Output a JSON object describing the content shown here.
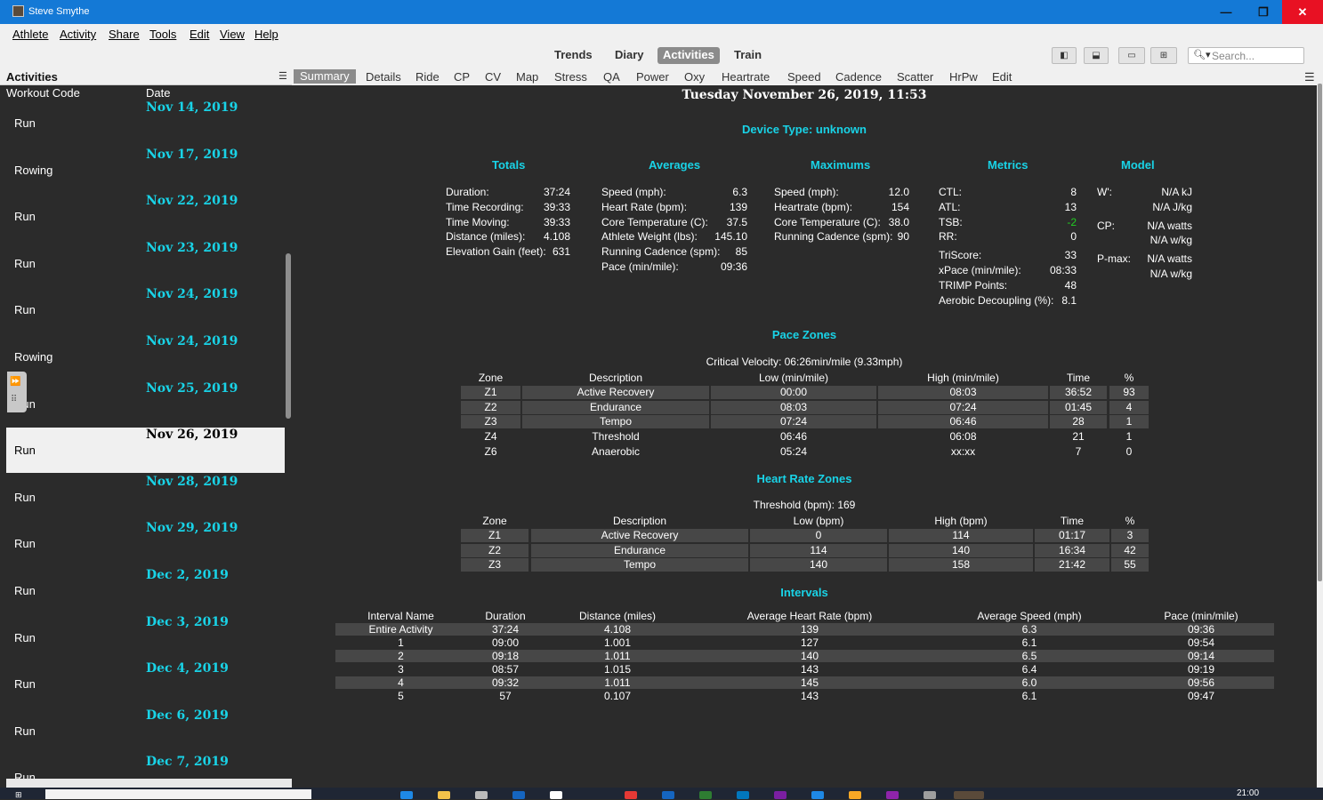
{
  "window": {
    "title": "Steve Smythe",
    "min": "—",
    "max": "❐",
    "close": "✕"
  },
  "menu": [
    "Athlete",
    "Activity",
    "Share",
    "Tools",
    "Edit",
    "View",
    "Help"
  ],
  "views": [
    "Trends",
    "Diary",
    "Activities",
    "Train"
  ],
  "active_view": "Activities",
  "search_placeholder": "Search...",
  "sidebar": {
    "title": "Activities",
    "col_code": "Workout Code",
    "col_date": "Date",
    "items": [
      {
        "date": "Nov 14, 2019",
        "type": "Run"
      },
      {
        "date": "Nov 17, 2019",
        "type": "Rowing"
      },
      {
        "date": "Nov 22, 2019",
        "type": "Run"
      },
      {
        "date": "Nov 23, 2019",
        "type": "Run"
      },
      {
        "date": "Nov 24, 2019",
        "type": "Run"
      },
      {
        "date": "Nov 24, 2019",
        "type": "Rowing"
      },
      {
        "date": "Nov 25, 2019",
        "type": "Run"
      },
      {
        "date": "Nov 26, 2019",
        "type": "Run",
        "selected": true
      },
      {
        "date": "Nov 28, 2019",
        "type": "Run"
      },
      {
        "date": "Nov 29, 2019",
        "type": "Run"
      },
      {
        "date": "Dec 2, 2019",
        "type": "Run"
      },
      {
        "date": "Dec 3, 2019",
        "type": "Run"
      },
      {
        "date": "Dec 4, 2019",
        "type": "Run"
      },
      {
        "date": "Dec 6, 2019",
        "type": "Run"
      },
      {
        "date": "Dec 7, 2019",
        "type": "Run"
      }
    ]
  },
  "tabs": [
    "Summary",
    "Details",
    "Ride",
    "CP",
    "CV",
    "Map",
    "Stress",
    "QA",
    "Power",
    "Oxy",
    "Heartrate",
    "Speed",
    "Cadence",
    "Scatter",
    "HrPw",
    "Edit"
  ],
  "active_tab": "Summary",
  "summary": {
    "datetime": "Tuesday November 26, 2019, 11:53",
    "device": "Device Type: unknown",
    "sections": {
      "totals": "Totals",
      "averages": "Averages",
      "maximums": "Maximums",
      "metrics": "Metrics",
      "model": "Model"
    },
    "totals": [
      [
        "Duration:",
        "37:24"
      ],
      [
        "Time Recording:",
        "39:33"
      ],
      [
        "Time Moving:",
        "39:33"
      ],
      [
        "Distance (miles):",
        "4.108"
      ],
      [
        "Elevation Gain (feet):",
        "631"
      ]
    ],
    "averages": [
      [
        "Speed (mph):",
        "6.3"
      ],
      [
        "Heart Rate (bpm):",
        "139"
      ],
      [
        "Core Temperature (C):",
        "37.5"
      ],
      [
        "Athlete Weight (lbs):",
        "145.10"
      ],
      [
        "Running Cadence (spm):",
        "85"
      ],
      [
        "Pace (min/mile):",
        "09:36"
      ]
    ],
    "maximums": [
      [
        "Speed (mph):",
        "12.0"
      ],
      [
        "Heartrate (bpm):",
        "154"
      ],
      [
        "Core Temperature (C):",
        "38.0"
      ],
      [
        "Running Cadence (spm):",
        "90"
      ]
    ],
    "metrics": [
      [
        "CTL:",
        "8"
      ],
      [
        "ATL:",
        "13"
      ],
      [
        "TSB:",
        "-2"
      ],
      [
        "RR:",
        "0"
      ],
      [
        "TriScore:",
        "33"
      ],
      [
        "xPace (min/mile):",
        "08:33"
      ],
      [
        "TRIMP Points:",
        "48"
      ],
      [
        "Aerobic Decoupling (%):",
        "8.1"
      ]
    ],
    "model": [
      [
        "W':",
        "N/A kJ"
      ],
      [
        "",
        "N/A J/kg"
      ],
      [
        "CP:",
        "N/A watts"
      ],
      [
        "",
        "N/A w/kg"
      ],
      [
        "P-max:",
        "N/A watts"
      ],
      [
        "",
        "N/A w/kg"
      ]
    ],
    "tsb_color": "#22cc22",
    "pace_zones": {
      "title": "Pace Zones",
      "subtitle": "Critical Velocity: 06:26min/mile (9.33mph)",
      "headers": [
        "Zone",
        "Description",
        "Low (min/mile)",
        "High (min/mile)",
        "Time",
        "%"
      ],
      "rows": [
        [
          "Z1",
          "Active Recovery",
          "00:00",
          "08:03",
          "36:52",
          "93"
        ],
        [
          "Z2",
          "Endurance",
          "08:03",
          "07:24",
          "01:45",
          "4"
        ],
        [
          "Z3",
          "Tempo",
          "07:24",
          "06:46",
          "28",
          "1"
        ],
        [
          "Z4",
          "Threshold",
          "06:46",
          "06:08",
          "21",
          "1"
        ],
        [
          "Z6",
          "Anaerobic",
          "05:24",
          "xx:xx",
          "7",
          "0"
        ]
      ]
    },
    "hr_zones": {
      "title": "Heart Rate Zones",
      "subtitle": "Threshold (bpm): 169",
      "headers": [
        "Zone",
        "Description",
        "Low (bpm)",
        "High (bpm)",
        "Time",
        "%"
      ],
      "rows": [
        [
          "Z1",
          "Active Recovery",
          "0",
          "114",
          "01:17",
          "3"
        ],
        [
          "Z2",
          "Endurance",
          "114",
          "140",
          "16:34",
          "42"
        ],
        [
          "Z3",
          "Tempo",
          "140",
          "158",
          "21:42",
          "55"
        ]
      ]
    },
    "intervals": {
      "title": "Intervals",
      "headers": [
        "Interval Name",
        "Duration",
        "Distance (miles)",
        "Average Heart Rate (bpm)",
        "Average Speed (mph)",
        "Pace (min/mile)"
      ],
      "rows": [
        [
          "Entire Activity",
          "37:24",
          "4.108",
          "139",
          "6.3",
          "09:36"
        ],
        [
          "1",
          "09:00",
          "1.001",
          "127",
          "6.1",
          "09:54"
        ],
        [
          "2",
          "09:18",
          "1.011",
          "140",
          "6.5",
          "09:14"
        ],
        [
          "3",
          "08:57",
          "1.015",
          "143",
          "6.4",
          "09:19"
        ],
        [
          "4",
          "09:32",
          "1.011",
          "145",
          "6.0",
          "09:56"
        ],
        [
          "5",
          "57",
          "0.107",
          "143",
          "6.1",
          "09:47"
        ]
      ]
    }
  },
  "taskbar": {
    "clock": "21:00"
  }
}
